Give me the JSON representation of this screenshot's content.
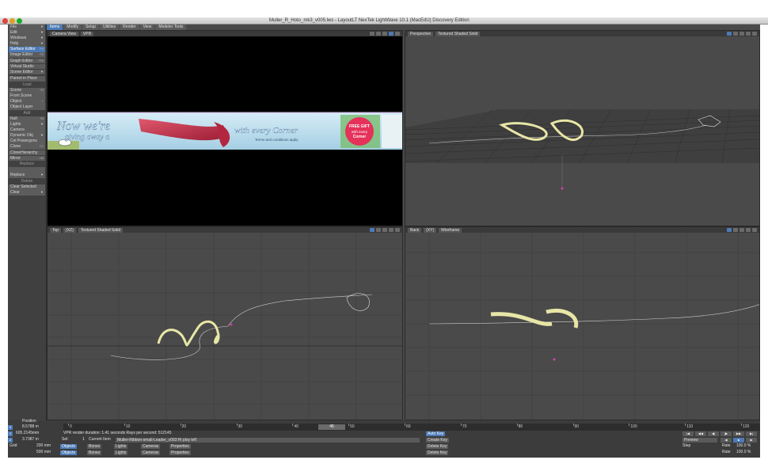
{
  "window": {
    "title": "Muller_R_Hoto_mk3_v005.lws - LayoutLT NexTek LightWave 10.1 (MacEdU) Discovery Edition"
  },
  "tabs": [
    "Items",
    "Modify",
    "Setup",
    "Utilities",
    "Render",
    "View",
    "Modeler Tools"
  ],
  "sidebar": {
    "top_items": [
      {
        "label": "File",
        "arrow": "▼"
      },
      {
        "label": "Edit",
        "arrow": "▼"
      },
      {
        "label": "Windows",
        "arrow": "▼"
      },
      {
        "label": "Help",
        "arrow": "▼"
      },
      {
        "label": "Surface Editor",
        "shortcut": "F5",
        "hl": true
      },
      {
        "label": "Image Editor",
        "shortcut": "F6"
      },
      {
        "label": "Graph Editor",
        "shortcut": "^F2"
      },
      {
        "label": "Virtual Studio",
        "shortcut": ""
      },
      {
        "label": "Scene Editor",
        "arrow": "▼"
      }
    ],
    "parent_in_place": "Parent in Place",
    "load_header": "Load",
    "load_items": [
      {
        "label": "Scene",
        "shortcut": "^O"
      },
      {
        "label": "From Scene",
        "shortcut": ""
      },
      {
        "label": "Object",
        "shortcut": "+"
      },
      {
        "label": "Object Layer",
        "shortcut": ""
      }
    ],
    "add_header": "Add",
    "add_items": [
      {
        "label": "Null",
        "shortcut": "^N"
      },
      {
        "label": "Lights",
        "arrow": "▼"
      },
      {
        "label": "Camera",
        "shortcut": ""
      },
      {
        "label": "Dynamic Obj",
        "arrow": "▼"
      },
      {
        "label": "Cel Powergons",
        "shortcut": ""
      },
      {
        "label": "Clone",
        "shortcut": "+C"
      },
      {
        "label": "CloneHierarchy",
        "shortcut": ""
      },
      {
        "label": "Mirror",
        "shortcut": "+M"
      }
    ],
    "replace_header": "Replace",
    "replace_items": [
      {
        "label": "",
        "shortcut": ""
      },
      {
        "label": "Replace",
        "arrow": "▼"
      }
    ],
    "delete_header": "Delete",
    "delete_items": [
      {
        "label": "Clear Selected",
        "shortcut": ""
      },
      {
        "label": "Clear",
        "arrow": "▼"
      }
    ]
  },
  "viewports": {
    "top_left": {
      "view": "Camera View",
      "mode": "VPR"
    },
    "top_right": {
      "view": "Perspective",
      "mode": "Textured Shaded Solid"
    },
    "bottom_left": {
      "view": "Top",
      "axes": "(XZ)",
      "mode": "Textured Shaded Solid"
    },
    "bottom_right": {
      "view": "Back",
      "axes": "(XY)",
      "mode": "Wireframe"
    }
  },
  "banner": {
    "line1": "Now we're",
    "line2": "giving away a",
    "right": "with every Corner",
    "terms": "Terms and conditions apply",
    "badge1": "FREE GIFT",
    "badge2": "with every",
    "badge3": "Corner"
  },
  "bottom": {
    "position_label": "Position",
    "x_axis": "X",
    "x_value": "8.5788 m",
    "y_axis": "Y",
    "y_value": "605.2145mm",
    "z_axis": "Z",
    "z_value": "3.7387 m",
    "grid_label": "Grid",
    "grid_value1": "200 mm",
    "grid_value2": "500 mm",
    "vpr_status": "VPR render duration: 1.41 seconds  Rays per second: 512145",
    "current_item_label": "Current Item",
    "current_item": "Muller-Ribbon-small-Leader_v003:Hi ploy left",
    "sel_label": "Sel:",
    "sel_value": "1",
    "objects": "Objects",
    "bones": "Bones",
    "lights": "Lights",
    "cameras": "Cameras",
    "properties": "Properties",
    "auto_key": "Auto Key",
    "create_key": "Create Key",
    "delete_key": "Delete Key",
    "preview": "Preview",
    "rate_label": "Rate",
    "rate_value": "100.0 %",
    "step_label": "Step",
    "current_frame": "45",
    "frame_start": "0",
    "frame_end": "120",
    "ticks": [
      "0",
      "10",
      "20",
      "30",
      "40",
      "50",
      "60",
      "70",
      "80",
      "90",
      "100",
      "110",
      "120"
    ]
  },
  "colors": {
    "accent": "#4d7ab7",
    "ribbon_yellow": "#e8e6a6",
    "ribbon_red": "#c0324a",
    "background_dark": "#4a4a4a"
  }
}
